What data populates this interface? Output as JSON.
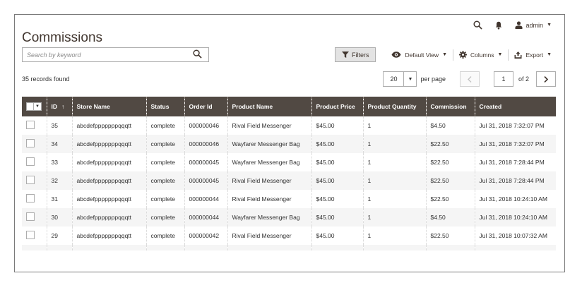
{
  "page": {
    "title": "Commissions"
  },
  "header": {
    "user_label": "admin"
  },
  "search": {
    "placeholder": "Search by keyword",
    "value": ""
  },
  "toolbar": {
    "filters_label": "Filters",
    "view_label": "Default View",
    "columns_label": "Columns",
    "export_label": "Export"
  },
  "records": {
    "found_text": "35 records found"
  },
  "pager": {
    "per_page_value": "20",
    "per_page_label": "per page",
    "current_page": "1",
    "of_text": "of 2"
  },
  "columns": {
    "id": "ID",
    "store_name": "Store Name",
    "status": "Status",
    "order_id": "Order Id",
    "product_name": "Product Name",
    "product_price": "Product Price",
    "product_quantity": "Product Quantity",
    "commission": "Commission",
    "created": "Created",
    "sort_indicator": "↑"
  },
  "rows": [
    {
      "id": "35",
      "store_name": "abcdefpppppppqqqtt",
      "status": "complete",
      "order_id": "000000046",
      "product_name": "Rival Field Messenger",
      "product_price": "$45.00",
      "product_quantity": "1",
      "commission": "$4.50",
      "created": "Jul 31, 2018 7:32:07 PM"
    },
    {
      "id": "34",
      "store_name": "abcdefpppppppqqqtt",
      "status": "complete",
      "order_id": "000000046",
      "product_name": "Wayfarer Messenger Bag",
      "product_price": "$45.00",
      "product_quantity": "1",
      "commission": "$22.50",
      "created": "Jul 31, 2018 7:32:07 PM"
    },
    {
      "id": "33",
      "store_name": "abcdefpppppppqqqtt",
      "status": "complete",
      "order_id": "000000045",
      "product_name": "Wayfarer Messenger Bag",
      "product_price": "$45.00",
      "product_quantity": "1",
      "commission": "$22.50",
      "created": "Jul 31, 2018 7:28:44 PM"
    },
    {
      "id": "32",
      "store_name": "abcdefpppppppqqqtt",
      "status": "complete",
      "order_id": "000000045",
      "product_name": "Rival Field Messenger",
      "product_price": "$45.00",
      "product_quantity": "1",
      "commission": "$22.50",
      "created": "Jul 31, 2018 7:28:44 PM"
    },
    {
      "id": "31",
      "store_name": "abcdefpppppppqqqtt",
      "status": "complete",
      "order_id": "000000044",
      "product_name": "Rival Field Messenger",
      "product_price": "$45.00",
      "product_quantity": "1",
      "commission": "$22.50",
      "created": "Jul 31, 2018 10:24:10 AM"
    },
    {
      "id": "30",
      "store_name": "abcdefpppppppqqqtt",
      "status": "complete",
      "order_id": "000000044",
      "product_name": "Wayfarer Messenger Bag",
      "product_price": "$45.00",
      "product_quantity": "1",
      "commission": "$4.50",
      "created": "Jul 31, 2018 10:24:10 AM"
    },
    {
      "id": "29",
      "store_name": "abcdefpppppppqqqtt",
      "status": "complete",
      "order_id": "000000042",
      "product_name": "Rival Field Messenger",
      "product_price": "$45.00",
      "product_quantity": "1",
      "commission": "$22.50",
      "created": "Jul 31, 2018 10:07:32 AM"
    }
  ],
  "colors": {
    "header_bg": "#514943",
    "filters_bg": "#e3e3e3",
    "row_alt_bg": "#f5f5f5",
    "border": "#adadad"
  },
  "icons": {
    "search": "search-icon",
    "notifications": "bell-icon",
    "user": "user-icon",
    "filter": "funnel-icon",
    "view": "eye-icon",
    "columns": "gear-icon",
    "export": "export-icon"
  }
}
